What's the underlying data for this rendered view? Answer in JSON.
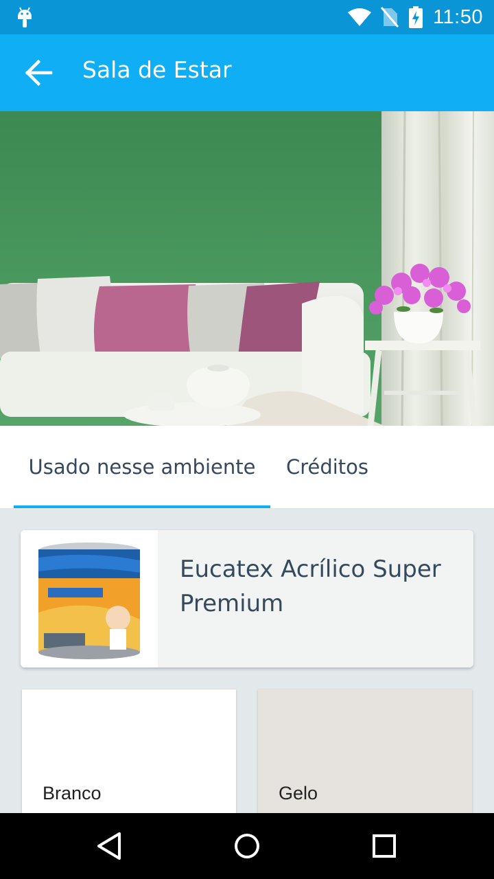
{
  "status_bar": {
    "time": "11:50",
    "icons": [
      "android-icon",
      "wifi-icon",
      "no-sim-icon",
      "battery-charging-icon"
    ]
  },
  "app_bar": {
    "title": "Sala de Estar",
    "back_icon": "arrow-back-icon"
  },
  "tabs": [
    {
      "label": "Usado nesse ambiente",
      "selected": true
    },
    {
      "label": "Créditos",
      "selected": false
    }
  ],
  "product": {
    "name": "Eucatex Acrílico Super Premium",
    "thumbnail_icon": "paint-can-icon"
  },
  "colors": [
    {
      "name": "Branco",
      "swatch": "#ffffff"
    },
    {
      "name": "Gelo",
      "swatch": "#e6e3df"
    }
  ],
  "theme": {
    "status_bar": "#0a96d6",
    "app_bar": "#10aef5",
    "accent": "#10aef5",
    "text": "#34495e",
    "background": "#e3e8eb"
  },
  "nav_bar": {
    "buttons": [
      "back-triangle-icon",
      "home-circle-icon",
      "recents-square-icon"
    ]
  }
}
